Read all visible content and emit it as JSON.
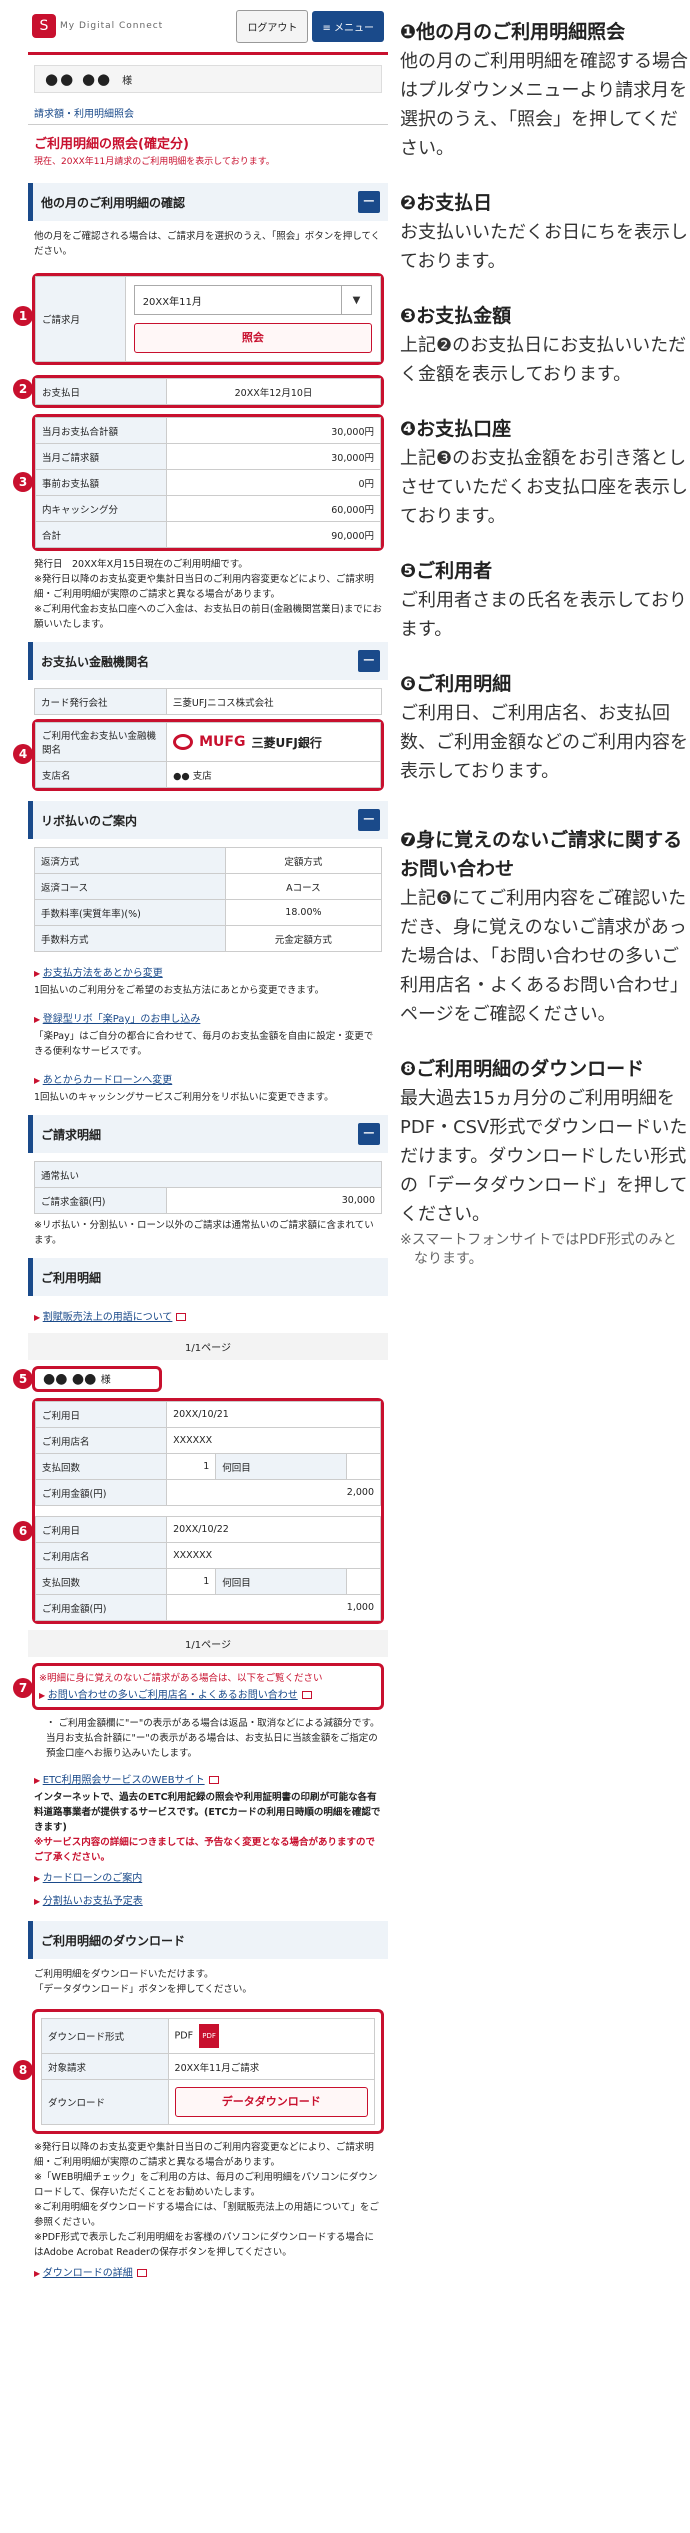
{
  "header": {
    "logo_mark": "S",
    "logo_text": "My Digital Connect",
    "logout": "ログアウト",
    "menu": "≡ メニュー"
  },
  "user": {
    "name": "●● ●●",
    "honorific": "様"
  },
  "breadcrumb": "請求額・利用明細照会",
  "page_title": "ご利用明細の照会(確定分)",
  "page_sub": "現在、20XX年11月請求のご利用明細を表示しております。",
  "sections": {
    "other_month": "他の月のご利用明細の確認",
    "other_month_text": "他の月をご確認される場合は、ご請求月を選択のうえ、「照会」ボタンを押してください。",
    "billing_month_label": "ご請求月",
    "billing_month_value": "20XX年11月",
    "inquiry_button": "照会",
    "pay_date_label": "お支払日",
    "pay_date_value": "20XX年12月10日",
    "bank": "お支払い金融機関名",
    "revo": "リボ払いのご案内",
    "statement": "ご請求明細",
    "usage": "ご利用明細",
    "download": "ご利用明細のダウンロード"
  },
  "amounts": [
    {
      "label": "当月お支払合計額",
      "value": "30,000円"
    },
    {
      "label": "当月ご請求額",
      "value": "30,000円"
    },
    {
      "label": "事前お支払額",
      "value": "0円"
    },
    {
      "label": "内キャッシング分",
      "value": "60,000円"
    },
    {
      "label": "合計",
      "value": "90,000円"
    }
  ],
  "amounts_note": "発行日　20XX年X月15日現在のご利用明細です。\n※発行日以降のお支払変更や集計日当日のご利用内容変更などにより、ご請求明細・ご利用明細が実際のご請求と異なる場合があります。\n※ご利用代金お支払口座へのご入金は、お支払日の前日(金融機関営業日)までにお願いいたします。",
  "bank_rows": [
    {
      "label": "カード発行会社",
      "value": "三菱UFJニコス株式会社"
    },
    {
      "label": "ご利用代金お支払い金融機関名",
      "value": "三菱UFJ銀行",
      "logo": "MUFG"
    },
    {
      "label": "支店名",
      "value": "●● 支店"
    }
  ],
  "revo_rows": [
    {
      "label": "返済方式",
      "value": "定額方式"
    },
    {
      "label": "返済コース",
      "value": "Aコース"
    },
    {
      "label": "手数料率(実質年率)(%)",
      "value": "18.00%"
    },
    {
      "label": "手数料方式",
      "value": "元金定額方式"
    }
  ],
  "revo_links": [
    {
      "link": "お支払方法をあとから変更",
      "text": "1回払いのご利用分をご希望のお支払方法にあとから変更できます。"
    },
    {
      "link": "登録型リボ「楽Pay」のお申し込み",
      "text": "「楽Pay」はご自分の都合に合わせて、毎月のお支払金額を自由に設定・変更できる便利なサービスです。"
    },
    {
      "link": "あとからカードローンへ変更",
      "text": "1回払いのキャッシングサービスご利用分をリボ払いに変更できます。"
    }
  ],
  "statement_rows": [
    {
      "label": "通常払い",
      "value": ""
    },
    {
      "label": "ご請求金額(円)",
      "value": "30,000"
    }
  ],
  "statement_note": "※リボ払い・分割払い・ローン以外のご請求は通常払いのご請求額に含まれています。",
  "usage_link": "割賦販売法上の用語について",
  "pager": "1/1ページ",
  "usage_user": "●● ●●",
  "usage_user_hon": "様",
  "usage_items": [
    {
      "date": "20XX/10/21",
      "store": "XXXXXX",
      "count": "1",
      "nth": "何回目",
      "amount": "2,000"
    },
    {
      "date": "20XX/10/22",
      "store": "XXXXXX",
      "count": "1",
      "nth": "何回目",
      "amount": "1,000"
    }
  ],
  "usage_labels": {
    "date": "ご利用日",
    "store": "ご利用店名",
    "count": "支払回数",
    "amount": "ご利用金額(円)"
  },
  "inquiry_box": {
    "text": "※明細に身に覚えのないご請求がある場合は、以下をご覧ください",
    "link": "お問い合わせの多いご利用店名・よくあるお問い合わせ"
  },
  "usage_bottom_note": "・ ご利用金額欄に\"ー\"の表示がある場合は返品・取消などによる減額分です。当月お支払合計額に\"ー\"の表示がある場合は、お支払日に当該金額をご指定の預金口座へお振り込みいたします。",
  "etc": {
    "link": "ETC利用照会サービスのWEBサイト",
    "text": "インターネットで、過去のETC利用記録の照会や利用証明書の印刷が可能な各有料道路事業者が提供するサービスです。(ETCカードの利用日時順の明細を確認できます)",
    "red": "※サービス内容の詳細につきましては、予告なく変更となる場合がありますのでご了承ください。"
  },
  "more_links": [
    "カードローンのご案内",
    "分割払いお支払予定表"
  ],
  "download": {
    "text": "ご利用明細をダウンロードいただけます。\n「データダウンロード」ボタンを押してください。",
    "format_label": "ダウンロード形式",
    "format_value": "PDF",
    "pdf_icon": "PDF",
    "target_label": "対象請求",
    "target_value": "20XX年11月ご請求",
    "dl_label": "ダウンロード",
    "dl_button": "データダウンロード",
    "notes": "※発行日以降のお支払変更や集計日当日のご利用内容変更などにより、ご請求明細・ご利用明細が実際のご請求と異なる場合があります。\n※「WEB明細チェック」をご利用の方は、毎月のご利用明細をパソコンにダウンロードして、保存いただくことをお勧めいたします。\n※ご利用明細をダウンロードする場合には、「割賦販売法上の用語について」をご参照ください。\n※PDF形式で表示したご利用明細をお客様のパソコンにダウンロードする場合にはAdobe Acrobat Readerの保存ボタンを押してください。",
    "detail_link": "ダウンロードの詳細"
  },
  "numbers": [
    "1",
    "2",
    "3",
    "4",
    "5",
    "6",
    "7",
    "8"
  ],
  "annotations": [
    {
      "title": "❶他の月のご利用明細照会",
      "body": "他の月のご利用明細を確認する場合はプルダウンメニューより請求月を選択のうえ、「照会」を押してください。"
    },
    {
      "title": "❷お支払日",
      "body": "お支払いいただくお日にちを表示しております。"
    },
    {
      "title": "❸お支払金額",
      "body": "上記❷のお支払日にお支払いいただく金額を表示しております。"
    },
    {
      "title": "❹お支払口座",
      "body": "上記❸のお支払金額をお引き落としさせていただくお支払口座を表示しております。"
    },
    {
      "title": "❺ご利用者",
      "body": "ご利用者さまの氏名を表示しております。"
    },
    {
      "title": "❻ご利用明細",
      "body": "ご利用日、ご利用店名、お支払回数、ご利用金額などのご利用内容を表示しております。"
    },
    {
      "title": "❼身に覚えのないご請求に関するお問い合わせ",
      "body": "上記❻にてご利用内容をご確認いただき、身に覚えのないご請求があった場合は、「お問い合わせの多いご利用店名・よくあるお問い合わせ」ページをご確認ください。"
    },
    {
      "title": "❽ご利用明細のダウンロード",
      "body": "最大過去15ヵ月分のご利用明細をPDF・CSV形式でダウンロードいただけます。ダウンロードしたい形式の「データダウンロード」を押してください。",
      "note": "※スマートフォンサイトではPDF形式のみとなります。"
    }
  ],
  "colors": {
    "brand_red": "#c8102e",
    "brand_blue": "#1a4a8a"
  }
}
